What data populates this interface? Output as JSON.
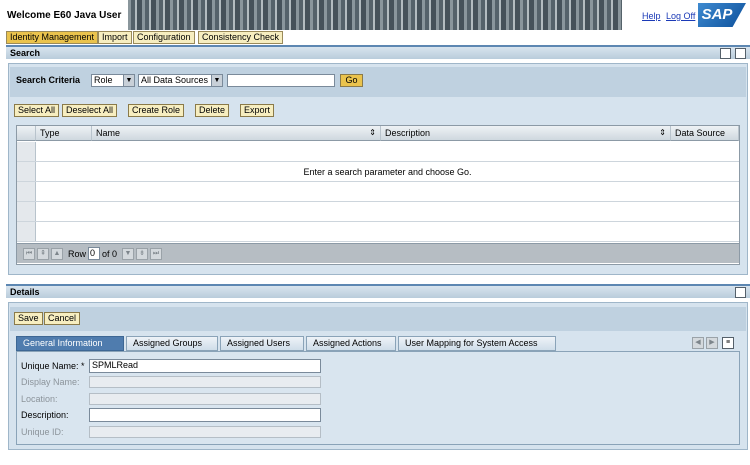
{
  "header": {
    "title": "Welcome E60 Java User",
    "help": "Help",
    "logoff": "Log Off",
    "logo": "SAP"
  },
  "nav": {
    "tabs": [
      "Identity Management",
      "Import",
      "Configuration",
      "Consistency Check"
    ]
  },
  "search": {
    "title": "Search",
    "criteria_label": "Search Criteria",
    "type_value": "Role",
    "source_value": "All Data Sources",
    "query": "",
    "go": "Go",
    "buttons": [
      "Select All",
      "Deselect All",
      "Create Role",
      "Delete",
      "Export"
    ],
    "columns": [
      "Type",
      "Name",
      "Description",
      "Data Source"
    ],
    "empty_message": "Enter a search parameter and choose Go.",
    "pager": {
      "label": "Row",
      "current": "0",
      "of": "of 0"
    }
  },
  "details": {
    "title": "Details",
    "save": "Save",
    "cancel": "Cancel",
    "tabs": [
      "General Information",
      "Assigned Groups",
      "Assigned Users",
      "Assigned Actions",
      "User Mapping for System Access"
    ],
    "fields": {
      "unique_name_label": "Unique Name: *",
      "unique_name_value": "SPMLRead",
      "display_name_label": "Display Name:",
      "location_label": "Location:",
      "description_label": "Description:",
      "unique_id_label": "Unique ID:"
    }
  },
  "colors": {
    "accent": "#4f7cae",
    "button": "#f7eec0",
    "selected_nav": "#eac34d",
    "tray": "#d6e3ee"
  }
}
